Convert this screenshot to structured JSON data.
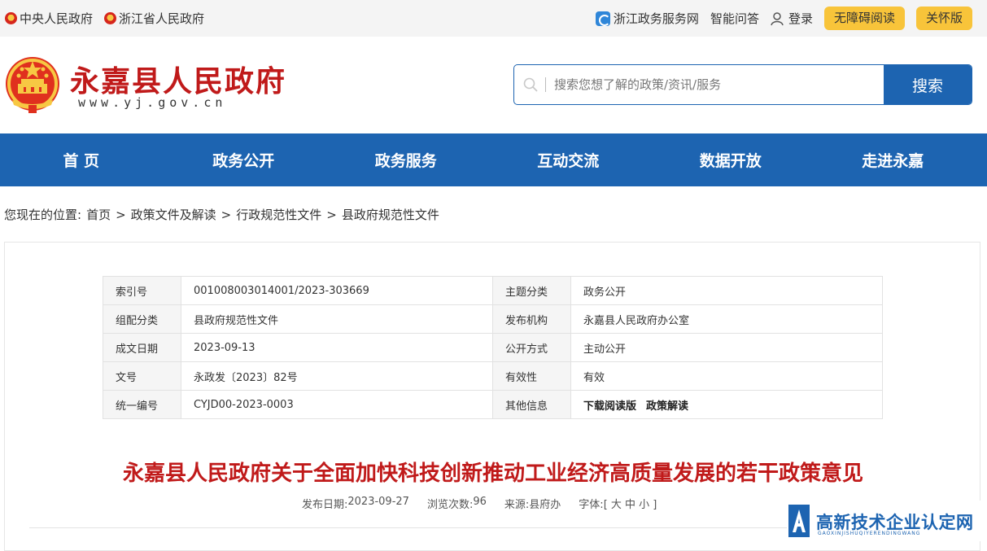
{
  "topbar": {
    "left_links": [
      "中央人民政府",
      "浙江省人民政府"
    ],
    "zj_service": "浙江政务服务网",
    "smart_qa": "智能问答",
    "login": "登录",
    "accessible": "无障碍阅读",
    "care": "关怀版"
  },
  "header": {
    "title": "永嘉县人民政府",
    "url": "www.yj.gov.cn",
    "search_placeholder": "搜索您想了解的政策/资讯/服务",
    "search_button": "搜索"
  },
  "nav": [
    "首 页",
    "政务公开",
    "政务服务",
    "互动交流",
    "数据开放",
    "走进永嘉"
  ],
  "breadcrumb": {
    "prefix": "您现在的位置:",
    "items": [
      "首页",
      "政策文件及解读",
      "行政规范性文件",
      "县政府规范性文件"
    ],
    "separator": ">"
  },
  "meta": {
    "rows": [
      {
        "k1": "索引号",
        "v1": "001008003014001/2023-303669",
        "k2": "主题分类",
        "v2": "政务公开"
      },
      {
        "k1": "组配分类",
        "v1": "县政府规范性文件",
        "k2": "发布机构",
        "v2": "永嘉县人民政府办公室"
      },
      {
        "k1": "成文日期",
        "v1": "2023-09-13",
        "k2": "公开方式",
        "v2": "主动公开"
      },
      {
        "k1": "文号",
        "v1": "永政发〔2023〕82号",
        "k2": "有效性",
        "v2": "有效"
      }
    ],
    "last_row": {
      "k1": "统一编号",
      "v1": "CYJD00-2023-0003",
      "k2": "其他信息",
      "link1": "下载阅读版",
      "link2": "政策解读"
    }
  },
  "article": {
    "title": "永嘉县人民政府关于全面加快科技创新推动工业经济高质量发展的若干政策意见",
    "date_label": "发布日期:",
    "date": "2023-09-27",
    "views_label": "浏览次数:",
    "views": "96",
    "source_label": "来源:",
    "source": "县府办",
    "font_label": "字体:",
    "font_options": "[ 大 中 小 ]"
  },
  "watermark": {
    "text": "高新技术企业认定网",
    "sub": "GAOXINJISHUQIYERENDINGWANG"
  },
  "colors": {
    "brand_blue": "#1d64b1",
    "title_red": "#c01a1a",
    "pill_yellow": "#f8c43a"
  }
}
